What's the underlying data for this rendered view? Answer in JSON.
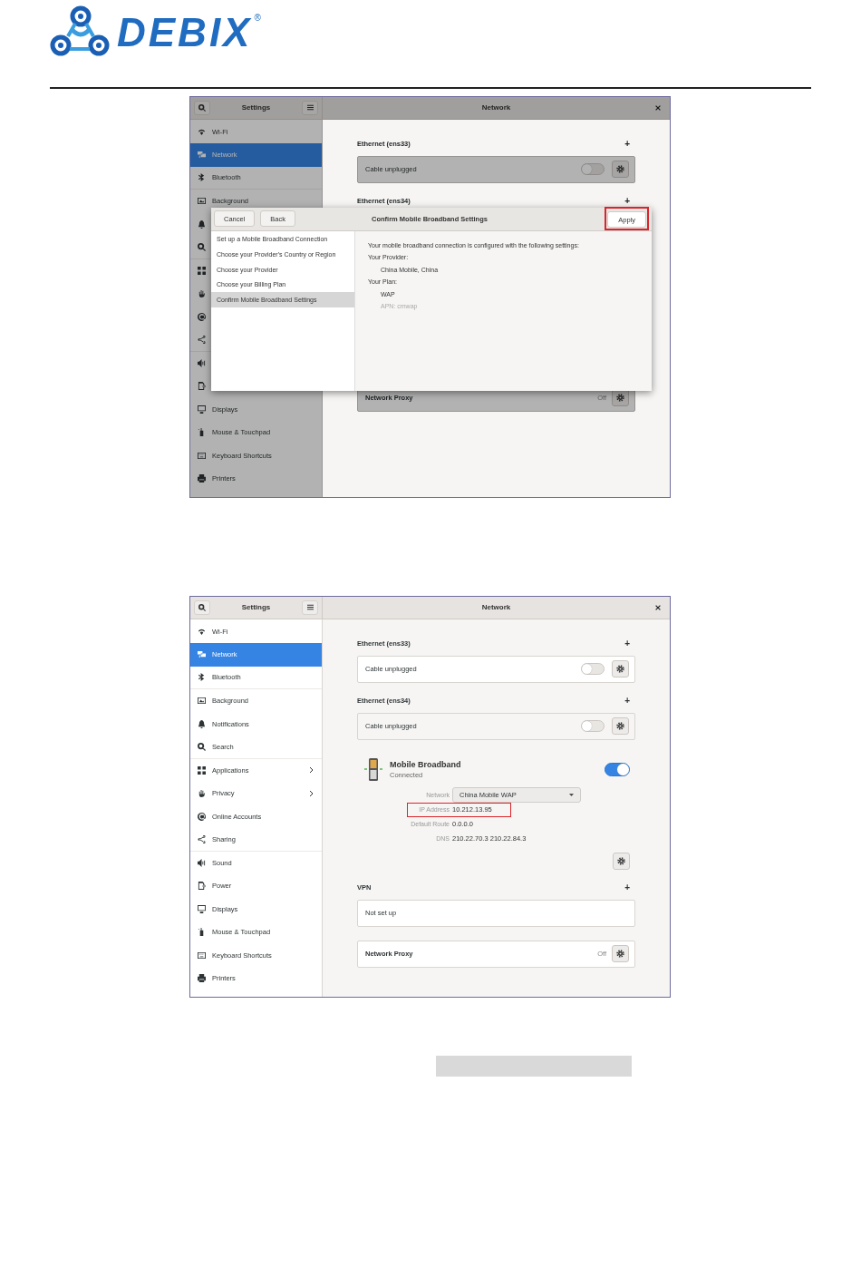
{
  "logo": {
    "wordmark": "DEBIX",
    "mark": "®"
  },
  "screenshots": [
    {
      "dimmed": true,
      "header": {
        "sidebar_title": "Settings",
        "title": "Network"
      },
      "sidebar": [
        {
          "label": "Wi-Fi",
          "selected": false
        },
        {
          "label": "Network",
          "selected": true
        },
        {
          "label": "Bluetooth",
          "selected": false
        },
        {
          "label": "Background",
          "selected": false
        },
        {
          "selected": false
        },
        {
          "selected": false
        },
        {
          "selected": false
        },
        {
          "selected": false
        },
        {
          "selected": false
        },
        {
          "selected": false
        },
        {
          "selected": false
        },
        {
          "selected": false
        },
        {
          "label": "Displays",
          "selected": false
        },
        {
          "label": "Mouse & Touchpad",
          "selected": false
        },
        {
          "label": "Keyboard Shortcuts",
          "selected": false
        },
        {
          "label": "Printers",
          "selected": false
        }
      ],
      "content": [
        {
          "kind": "heading",
          "title": "Ethernet (ens33)",
          "add": "+"
        },
        {
          "kind": "toggle_card",
          "label": "Cable unplugged",
          "toggle": {
            "on": false
          }
        },
        {
          "kind": "heading",
          "title": "Ethernet (ens34)",
          "add": "+"
        },
        {
          "kind": "gap"
        },
        {
          "kind": "proxy_card",
          "label": "Network Proxy",
          "status": "Off"
        }
      ],
      "dialog": {
        "buttons": [
          {
            "label": "Cancel"
          },
          {
            "label": "Back"
          }
        ],
        "title": "Confirm Mobile Broadband Settings",
        "apply": {
          "label": "Apply",
          "highlighted": true
        },
        "steps": [
          {
            "label": "Set up a Mobile Broadband Connection",
            "selected": false
          },
          {
            "label": "Choose your Provider's Country or Region",
            "selected": false
          },
          {
            "label": "Choose your Provider",
            "selected": false
          },
          {
            "label": "Choose your Billing Plan",
            "selected": false
          },
          {
            "label": "Confirm Mobile Broadband Settings",
            "selected": true
          }
        ],
        "summary": [
          {
            "kind": "line",
            "text": "Your mobile broadband connection is configured with the following settings:"
          },
          {
            "kind": "line",
            "text": "Your Provider:"
          },
          {
            "kind": "indent",
            "text": "China Mobile, China"
          },
          {
            "kind": "line",
            "text": "Your Plan:"
          },
          {
            "kind": "indent",
            "text": "WAP"
          },
          {
            "kind": "hint",
            "text": "APN: cmwap"
          }
        ]
      }
    },
    {
      "dimmed": false,
      "header": {
        "sidebar_title": "Settings",
        "title": "Network"
      },
      "sidebar": [
        {
          "label": "Wi-Fi",
          "selected": false,
          "submenu": false
        },
        {
          "label": "Network",
          "selected": true,
          "submenu": false
        },
        {
          "label": "Bluetooth",
          "selected": false,
          "submenu": false
        },
        {
          "label": "Background",
          "selected": false,
          "submenu": false
        },
        {
          "label": "Notifications",
          "selected": false,
          "submenu": false
        },
        {
          "label": "Search",
          "selected": false,
          "submenu": false
        },
        {
          "label": "Applications",
          "selected": false,
          "submenu": true
        },
        {
          "label": "Privacy",
          "selected": false,
          "submenu": true
        },
        {
          "label": "Online Accounts",
          "selected": false,
          "submenu": false
        },
        {
          "label": "Sharing",
          "selected": false,
          "submenu": false
        },
        {
          "label": "Sound",
          "selected": false,
          "submenu": false
        },
        {
          "label": "Power",
          "selected": false,
          "submenu": false
        },
        {
          "label": "Displays",
          "selected": false,
          "submenu": false
        },
        {
          "label": "Mouse & Touchpad",
          "selected": false,
          "submenu": false
        },
        {
          "label": "Keyboard Shortcuts",
          "selected": false,
          "submenu": false
        },
        {
          "label": "Printers",
          "selected": false,
          "submenu": false
        }
      ],
      "content": [
        {
          "kind": "heading",
          "title": "Ethernet (ens33)",
          "add": "+"
        },
        {
          "kind": "toggle_card",
          "label": "Cable unplugged",
          "toggle": {
            "on": false
          }
        },
        {
          "kind": "heading",
          "title": "Ethernet (ens34)",
          "add": "+"
        },
        {
          "kind": "toggle_card",
          "label": "Cable unplugged",
          "toggle": {
            "on": false
          }
        },
        {
          "kind": "mobile",
          "title": "Mobile Broadband",
          "status": "Connected",
          "toggle": {
            "on": true
          },
          "details": [
            {
              "kind": "dropdown",
              "label": "Network",
              "value": "China Mobile WAP",
              "highlighted": false
            },
            {
              "kind": "text",
              "label": "IP Address",
              "value": "10.212.13.95",
              "highlighted": true
            },
            {
              "kind": "text",
              "label": "Default Route",
              "value": "0.0.0.0",
              "highlighted": false
            },
            {
              "kind": "text",
              "label": "DNS",
              "value": "210.22.70.3 210.22.84.3",
              "highlighted": false
            }
          ]
        },
        {
          "kind": "heading",
          "title": "VPN",
          "add": "+"
        },
        {
          "kind": "plain_card",
          "label": "Not set up"
        },
        {
          "kind": "proxy_card",
          "label": "Network Proxy",
          "status": "Off"
        }
      ]
    }
  ]
}
